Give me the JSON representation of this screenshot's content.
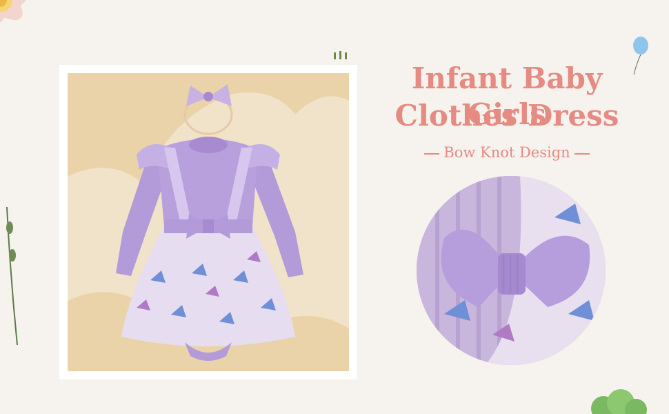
{
  "heading": {
    "line1": "Infant Baby Girls",
    "line2": "Clothes Dress",
    "subtitle": "Bow Knot Design"
  },
  "colors": {
    "accent": "#e58b82",
    "background": "#f6f3ee",
    "dress_purple": "#b39ad9",
    "photo_bg": "#f1e3c9"
  },
  "images": {
    "main_photo": "dress-product-photo",
    "detail_photo": "bow-closeup-photo"
  }
}
